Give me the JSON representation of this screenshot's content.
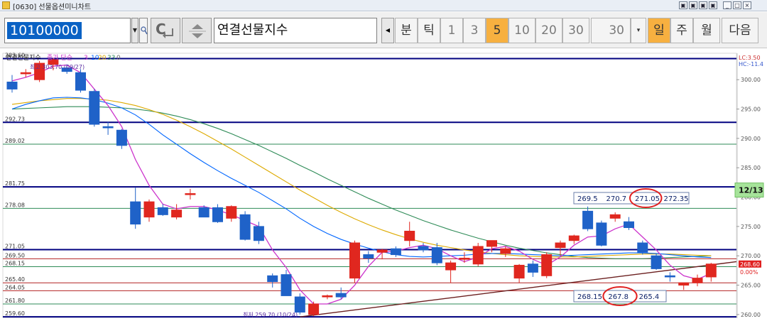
{
  "window": {
    "title": "[0630] 선물옵션미니차트",
    "controls": [
      "▣",
      "▣",
      "▣",
      "▣",
      "_",
      "□",
      "×"
    ]
  },
  "toolbar": {
    "code": "10100000",
    "name": "연결선물지수",
    "c_label": "C",
    "period_buttons": [
      {
        "label": "분",
        "active": false,
        "num": false
      },
      {
        "label": "틱",
        "active": false,
        "num": false
      },
      {
        "label": "1",
        "active": false,
        "num": true
      },
      {
        "label": "3",
        "active": false,
        "num": true
      },
      {
        "label": "5",
        "active": true,
        "num": true
      },
      {
        "label": "10",
        "active": false,
        "num": true
      },
      {
        "label": "20",
        "active": false,
        "num": true
      },
      {
        "label": "30",
        "active": false,
        "num": true
      }
    ],
    "count_value": "30",
    "day_buttons": [
      {
        "label": "일",
        "active": true
      },
      {
        "label": "주",
        "active": false
      },
      {
        "label": "월",
        "active": false
      },
      {
        "label": "다음",
        "active": false
      }
    ]
  },
  "chart": {
    "legend": {
      "name": "연결선물지수",
      "ma_label": "종가 단순",
      "ma_periods": [
        "3",
        "10",
        "20",
        "33",
        "0"
      ],
      "ma_colors": [
        "#cc33cc",
        "#0066ff",
        "#ddaa00",
        "#2e8b57",
        "#666666"
      ]
    },
    "high_label": "최고 303.70 (09/27)",
    "low_label": "최저 259.70 (10/24)",
    "lc_label": "LC:3.50",
    "hc_label": "HC:-11.4",
    "current_price": "268.60",
    "current_pct": "0.00%",
    "date_tag": "12/13",
    "y_ticks": [
      "300.00",
      "295.00",
      "290.00",
      "285.00",
      "280.00",
      "275.00",
      "270.00",
      "265.00",
      "260.00"
    ],
    "upper_box": [
      "269.5",
      "270.7",
      "271.05",
      "272.35"
    ],
    "lower_box": [
      "268.15",
      "267.8",
      "265.4"
    ],
    "hlines": [
      {
        "label": "303.60",
        "value": 303.6,
        "color": "#000080",
        "width": 2
      },
      {
        "label": "292.73",
        "value": 292.73,
        "color": "#000080",
        "width": 2
      },
      {
        "label": "289.02",
        "value": 289.02,
        "color": "#2e8b57",
        "width": 1
      },
      {
        "label": "281.75",
        "value": 281.75,
        "color": "#000080",
        "width": 2
      },
      {
        "label": "278.08",
        "value": 278.08,
        "color": "#2e8b57",
        "width": 1
      },
      {
        "label": "271.05",
        "value": 271.05,
        "color": "#000080",
        "width": 2
      },
      {
        "label": "269.50",
        "value": 269.5,
        "color": "#b22222",
        "width": 1
      },
      {
        "label": "268.15",
        "value": 268.15,
        "color": "#2e8b57",
        "width": 1
      },
      {
        "label": "265.40",
        "value": 265.4,
        "color": "#b22222",
        "width": 1
      },
      {
        "label": "264.05",
        "value": 264.05,
        "color": "#b22222",
        "width": 1
      },
      {
        "label": "261.80",
        "value": 261.8,
        "color": "#2e8b57",
        "width": 1
      },
      {
        "label": "259.60",
        "value": 259.6,
        "color": "#000080",
        "width": 2
      }
    ]
  },
  "chart_data": {
    "type": "candlestick",
    "ylim": [
      259.5,
      304.5
    ],
    "candles": [
      {
        "o": 299.6,
        "h": 300.8,
        "l": 297.8,
        "c": 298.4
      },
      {
        "o": 301.0,
        "h": 301.8,
        "l": 300.4,
        "c": 301.2
      },
      {
        "o": 300.0,
        "h": 303.2,
        "l": 299.6,
        "c": 302.8
      },
      {
        "o": 302.6,
        "h": 303.7,
        "l": 301.6,
        "c": 303.4
      },
      {
        "o": 302.0,
        "h": 302.6,
        "l": 301.0,
        "c": 301.4
      },
      {
        "o": 301.2,
        "h": 301.8,
        "l": 297.8,
        "c": 298.2
      },
      {
        "o": 298.0,
        "h": 298.4,
        "l": 292.0,
        "c": 292.4
      },
      {
        "o": 292.0,
        "h": 292.8,
        "l": 290.6,
        "c": 291.8
      },
      {
        "o": 291.4,
        "h": 291.6,
        "l": 288.2,
        "c": 288.8
      },
      {
        "o": 279.2,
        "h": 281.6,
        "l": 274.6,
        "c": 275.4
      },
      {
        "o": 276.6,
        "h": 279.6,
        "l": 275.8,
        "c": 279.2
      },
      {
        "o": 278.2,
        "h": 278.8,
        "l": 276.8,
        "c": 277.0
      },
      {
        "o": 276.6,
        "h": 278.8,
        "l": 276.2,
        "c": 277.8
      },
      {
        "o": 280.6,
        "h": 281.4,
        "l": 279.6,
        "c": 280.6
      },
      {
        "o": 278.2,
        "h": 278.6,
        "l": 276.6,
        "c": 276.6
      },
      {
        "o": 278.2,
        "h": 278.8,
        "l": 275.6,
        "c": 275.8
      },
      {
        "o": 276.4,
        "h": 278.6,
        "l": 275.8,
        "c": 278.4
      },
      {
        "o": 277.0,
        "h": 277.6,
        "l": 272.6,
        "c": 272.8
      },
      {
        "o": 275.0,
        "h": 275.8,
        "l": 272.0,
        "c": 272.6
      },
      {
        "o": 266.6,
        "h": 267.0,
        "l": 264.6,
        "c": 265.6
      },
      {
        "o": 266.8,
        "h": 267.6,
        "l": 263.4,
        "c": 263.2
      },
      {
        "o": 263.0,
        "h": 263.6,
        "l": 260.0,
        "c": 260.4
      },
      {
        "o": 260.0,
        "h": 262.2,
        "l": 259.7,
        "c": 261.8
      },
      {
        "o": 263.0,
        "h": 263.4,
        "l": 262.6,
        "c": 263.2
      },
      {
        "o": 263.6,
        "h": 264.6,
        "l": 262.6,
        "c": 263.0
      },
      {
        "o": 266.2,
        "h": 272.6,
        "l": 265.4,
        "c": 272.2
      },
      {
        "o": 270.2,
        "h": 270.8,
        "l": 268.8,
        "c": 269.6
      },
      {
        "o": 270.6,
        "h": 271.2,
        "l": 269.4,
        "c": 271.0
      },
      {
        "o": 271.2,
        "h": 271.6,
        "l": 269.8,
        "c": 270.2
      },
      {
        "o": 272.6,
        "h": 275.8,
        "l": 271.6,
        "c": 274.2
      },
      {
        "o": 271.6,
        "h": 272.2,
        "l": 270.6,
        "c": 271.0
      },
      {
        "o": 271.4,
        "h": 272.2,
        "l": 268.4,
        "c": 268.8
      },
      {
        "o": 267.6,
        "h": 269.2,
        "l": 265.4,
        "c": 268.8
      },
      {
        "o": 269.4,
        "h": 270.6,
        "l": 268.8,
        "c": 269.6
      },
      {
        "o": 268.6,
        "h": 272.2,
        "l": 268.2,
        "c": 271.6
      },
      {
        "o": 271.6,
        "h": 272.6,
        "l": 270.6,
        "c": 272.6
      },
      {
        "o": 270.4,
        "h": 271.6,
        "l": 269.8,
        "c": 271.2
      },
      {
        "o": 266.2,
        "h": 268.6,
        "l": 265.4,
        "c": 268.4
      },
      {
        "o": 268.6,
        "h": 269.2,
        "l": 266.4,
        "c": 267.2
      },
      {
        "o": 266.6,
        "h": 270.6,
        "l": 266.2,
        "c": 270.2
      },
      {
        "o": 271.4,
        "h": 272.6,
        "l": 270.0,
        "c": 272.2
      },
      {
        "o": 272.6,
        "h": 273.6,
        "l": 272.0,
        "c": 273.4
      },
      {
        "o": 277.6,
        "h": 278.4,
        "l": 274.2,
        "c": 274.6
      },
      {
        "o": 275.6,
        "h": 276.0,
        "l": 271.6,
        "c": 271.8
      },
      {
        "o": 276.4,
        "h": 277.4,
        "l": 275.8,
        "c": 277.0
      },
      {
        "o": 275.8,
        "h": 276.6,
        "l": 274.4,
        "c": 274.8
      },
      {
        "o": 272.2,
        "h": 272.6,
        "l": 270.2,
        "c": 270.6
      },
      {
        "o": 270.0,
        "h": 270.4,
        "l": 267.6,
        "c": 267.8
      },
      {
        "o": 266.6,
        "h": 267.2,
        "l": 265.6,
        "c": 266.4
      },
      {
        "o": 265.0,
        "h": 265.4,
        "l": 264.2,
        "c": 265.4
      },
      {
        "o": 265.4,
        "h": 266.8,
        "l": 264.8,
        "c": 266.2
      },
      {
        "o": 266.4,
        "h": 268.8,
        "l": 265.6,
        "c": 268.6
      }
    ],
    "ma3": [
      299.8,
      300.4,
      301.2,
      302.3,
      302.5,
      301.2,
      298.4,
      295.6,
      292.0,
      286.4,
      282.0,
      278.8,
      278.0,
      278.4,
      278.4,
      277.8,
      277.0,
      276.0,
      275.0,
      271.0,
      268.0,
      264.2,
      261.8,
      261.8,
      262.6,
      265.0,
      268.2,
      270.6,
      270.8,
      271.4,
      271.8,
      271.2,
      270.0,
      269.0,
      269.8,
      271.2,
      271.6,
      270.8,
      269.4,
      268.4,
      269.8,
      271.8,
      273.2,
      273.4,
      274.6,
      275.4,
      273.2,
      271.0,
      268.4,
      266.6,
      266.0,
      267.0
    ],
    "ma10": [
      295.0,
      295.8,
      296.4,
      296.9,
      297.0,
      296.9,
      296.6,
      296.0,
      295.2,
      294.0,
      292.4,
      290.6,
      289.0,
      287.4,
      285.9,
      284.5,
      283.2,
      282.0,
      280.8,
      279.4,
      278.0,
      276.4,
      275.0,
      273.8,
      272.8,
      272.0,
      271.3,
      270.7,
      270.2,
      269.9,
      269.8,
      269.9,
      270.0,
      270.1,
      270.3,
      270.4,
      270.4,
      270.3,
      270.2,
      270.1,
      270.0,
      270.1,
      270.2,
      270.3,
      270.4,
      270.5,
      270.5,
      270.4,
      270.2,
      270.0,
      269.8,
      269.7
    ],
    "ma20": [
      295.8,
      296.1,
      296.4,
      296.6,
      296.8,
      296.8,
      296.7,
      296.5,
      296.1,
      295.6,
      294.9,
      294.1,
      293.1,
      292.0,
      290.8,
      289.5,
      288.2,
      286.8,
      285.4,
      284.0,
      282.6,
      281.2,
      279.9,
      278.6,
      277.4,
      276.3,
      275.3,
      274.4,
      273.6,
      272.9,
      272.3,
      271.8,
      271.4,
      271.0,
      270.7,
      270.4,
      270.2,
      270.0,
      269.9,
      269.8,
      269.8,
      269.8,
      269.9,
      270.0,
      270.1,
      270.2,
      270.3,
      270.3,
      270.3,
      270.2,
      270.1,
      270.0
    ],
    "ma33": [
      295.0,
      295.1,
      295.2,
      295.3,
      295.4,
      295.4,
      295.4,
      295.3,
      295.2,
      295.0,
      294.7,
      294.3,
      293.8,
      293.2,
      292.5,
      291.7,
      290.8,
      289.8,
      288.8,
      287.7,
      286.6,
      285.4,
      284.3,
      283.1,
      282.0,
      280.9,
      279.8,
      278.8,
      277.8,
      276.9,
      276.0,
      275.2,
      274.4,
      273.7,
      273.0,
      272.4,
      271.8,
      271.3,
      270.9,
      270.5,
      270.2,
      269.9,
      269.7,
      269.6,
      269.5,
      269.5,
      269.5,
      269.6,
      269.7,
      269.8,
      269.9,
      270.0
    ]
  }
}
